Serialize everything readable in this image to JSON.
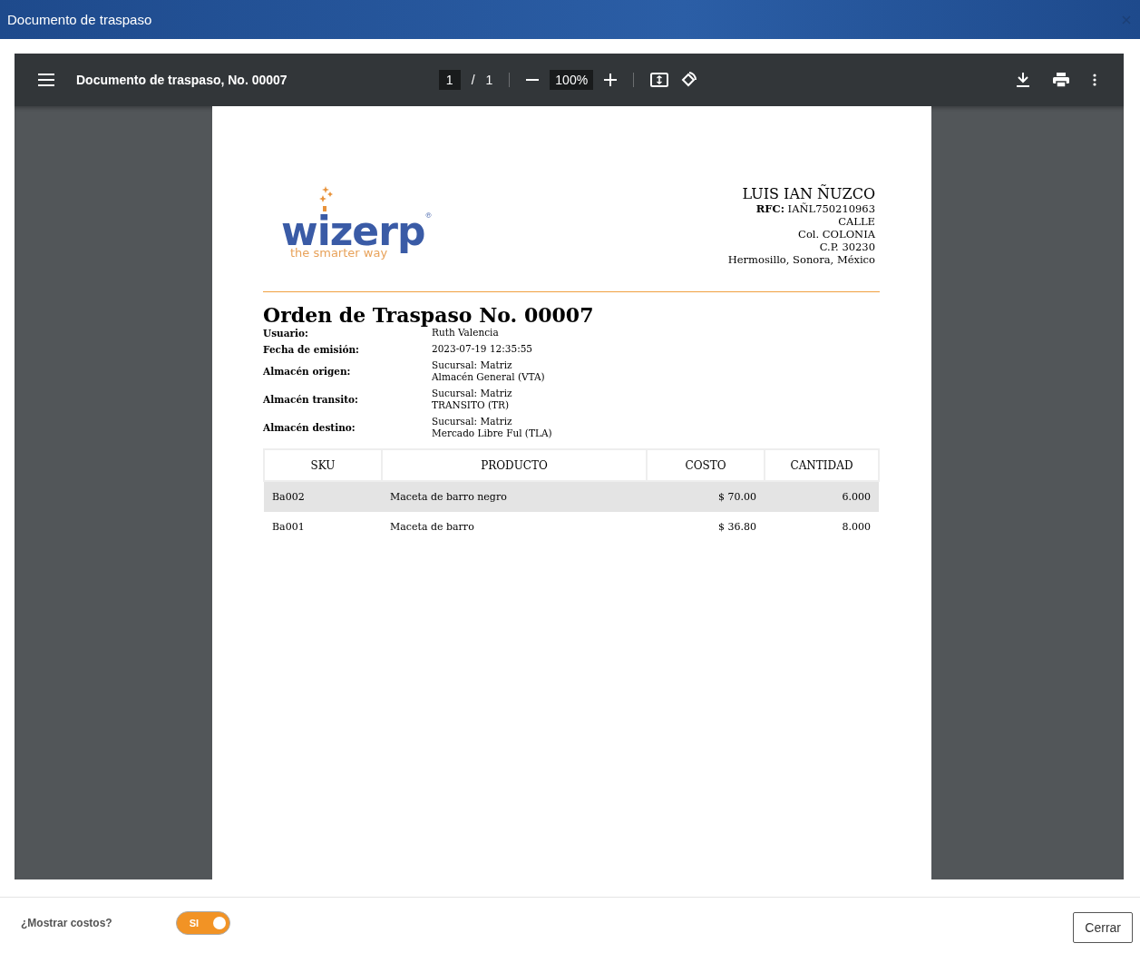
{
  "window": {
    "title": "Documento de traspaso"
  },
  "viewer": {
    "title": "Documento de traspaso, No. 00007",
    "page": "1",
    "page_sep": "/",
    "page_total": "1",
    "zoom": "100%"
  },
  "document": {
    "logo": {
      "word": "wizerp",
      "mark": "®",
      "tagline": "the smarter way"
    },
    "company": {
      "name": "LUIS IAN ÑUZCO",
      "rfc_label": "RFC:",
      "rfc": "IAÑL750210963",
      "lines": [
        "CALLE",
        "Col. COLONIA",
        "C.P. 30230",
        "Hermosillo, Sonora, México"
      ]
    },
    "heading": "Orden de Traspaso No. 00007",
    "fields": [
      {
        "label": "Usuario:",
        "values": [
          "Ruth Valencia"
        ]
      },
      {
        "label": "Fecha de emisión:",
        "values": [
          "2023-07-19 12:35:55"
        ]
      },
      {
        "label": "Almacén origen:",
        "values": [
          "Sucursal: Matriz",
          "Almacén General (VTA)"
        ]
      },
      {
        "label": "Almacén transito:",
        "values": [
          "Sucursal: Matriz",
          "TRANSITO (TR)"
        ]
      },
      {
        "label": "Almacén destino:",
        "values": [
          "Sucursal: Matriz",
          "Mercado Libre Ful (TLA)"
        ]
      }
    ],
    "table": {
      "columns": [
        "SKU",
        "PRODUCTO",
        "COSTO",
        "CANTIDAD"
      ],
      "rows": [
        {
          "shaded": true,
          "cells": [
            "Ba002",
            "Maceta de barro negro",
            "$ 70.00",
            "6.000"
          ]
        },
        {
          "shaded": false,
          "cells": [
            "Ba001",
            "Maceta de barro",
            "$ 36.80",
            "8.000"
          ]
        }
      ]
    }
  },
  "footer": {
    "toggle_label": "¿Mostrar costos?",
    "toggle": {
      "on": true,
      "text": "SI"
    },
    "close_button": "Cerrar"
  }
}
